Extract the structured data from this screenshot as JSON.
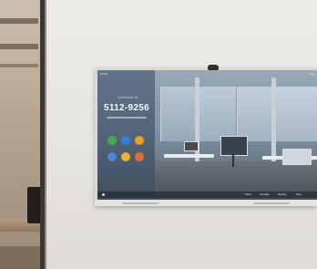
{
  "screen": {
    "meeting_label": "Conference ID",
    "meeting_id": "5112-9256",
    "status_time": "10:00",
    "status_right": "●●●",
    "apps": [
      {
        "icon": "phone-icon",
        "color": "#3fae4f"
      },
      {
        "icon": "edit-icon",
        "color": "#2f7de0"
      },
      {
        "icon": "folder-icon",
        "color": "#f0a21b"
      },
      {
        "icon": "camera-icon",
        "color": "#4a86e0"
      },
      {
        "icon": "share-icon",
        "color": "#f2b72a"
      },
      {
        "icon": "settings-icon",
        "color": "#e86d3a"
      }
    ],
    "taskbar_items": [
      "Share",
      "Annotate",
      "Meeting",
      "More"
    ]
  }
}
